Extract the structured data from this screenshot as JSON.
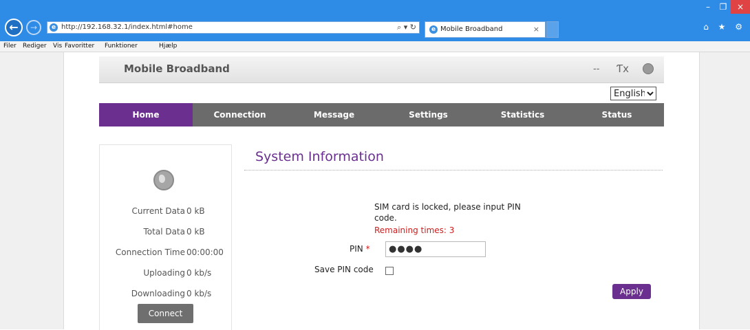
{
  "browser": {
    "url": "http://192.168.32.1/index.html#home",
    "url_controls": "⌕ ▾ ↻",
    "tab_title": "Mobile Broadband",
    "tab_close": "×",
    "back": "←",
    "forward": "→",
    "ie_glyph": "e",
    "window_controls": {
      "minimize": "–",
      "restore": "❐",
      "close": "×"
    },
    "toolbar_icons": "⌂ ★ ⚙",
    "menu": [
      "Filer",
      "Rediger",
      "Vis",
      "Favoritter",
      "Funktioner",
      "Hjælp"
    ]
  },
  "header": {
    "brand": "Mobile Broadband",
    "status_dash": "--",
    "signal_icon": "Ƭx",
    "language": "English",
    "language_options": [
      "English"
    ]
  },
  "nav": [
    "Home",
    "Connection",
    "Message",
    "Settings",
    "Statistics",
    "Status"
  ],
  "nav_active": "Home",
  "side": {
    "stats": [
      {
        "label": "Current Data",
        "value": "0 kB"
      },
      {
        "label": "Total Data",
        "value": "0 kB"
      },
      {
        "label": "Connection Time",
        "value": "00:00:00"
      },
      {
        "label": "Uploading",
        "value": "0 kb/s"
      },
      {
        "label": "Downloading",
        "value": "0 kb/s"
      }
    ],
    "connect_label": "Connect"
  },
  "main": {
    "title": "System Information",
    "message": "SIM card is locked, please input PIN code.",
    "remaining": "Remaining times: 3",
    "pin_label": "PIN",
    "required_mark": "*",
    "pin_value": "●●●●",
    "save_label": "Save PIN code",
    "apply_label": "Apply"
  },
  "colors": {
    "accent": "#6a2f8f",
    "nav": "#6b6b6b",
    "titlebar": "#2e8be6",
    "error": "#d01c1c"
  }
}
